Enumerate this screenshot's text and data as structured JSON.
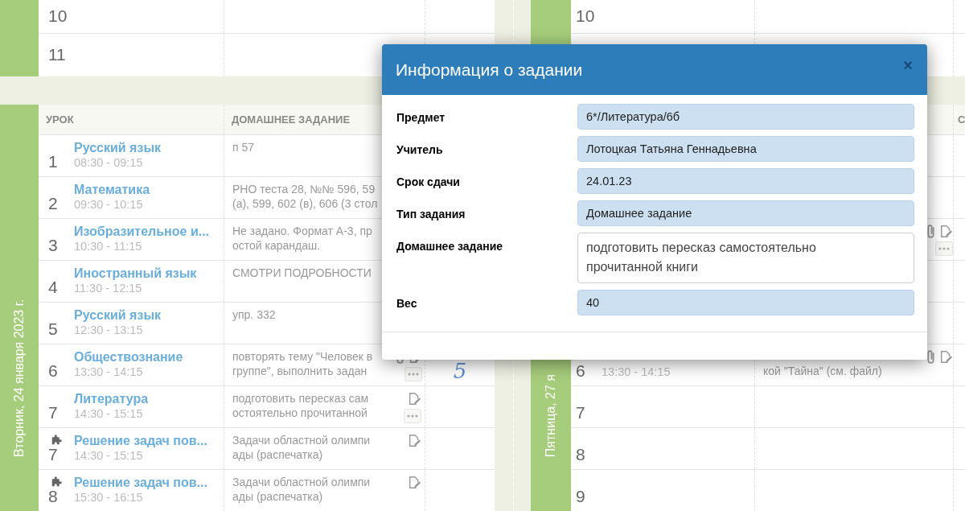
{
  "columns": [
    {
      "blocks": [
        {
          "kind": "tail",
          "rows": [
            {
              "number": "10"
            },
            {
              "number": "11"
            }
          ]
        },
        {
          "kind": "day",
          "date": "Вторник, 24 января 2023 г.",
          "headers": [
            "УРОК",
            "ДОМАШНЕЕ ЗАДАНИЕ"
          ],
          "rows": [
            {
              "number": "1",
              "title": "Русский язык",
              "time": "08:30 - 09:15",
              "homework": "п 57"
            },
            {
              "number": "2",
              "title": "Математика",
              "time": "09:30 - 10:15",
              "homework": "РНО теста 28, №№ 596, 59\n(а), 599, 602 (в), 606 (3 стол"
            },
            {
              "number": "3",
              "title": "Изобразительное и...",
              "time": "10:30 - 11:15",
              "homework": "Не задано. Формат А-3, пр\nостой карандаш."
            },
            {
              "number": "4",
              "title": "Иностранный язык",
              "time": "11:30 - 12:15",
              "homework": "СМОТРИ ПОДРОБНОСТИ"
            },
            {
              "number": "5",
              "title": "Русский язык",
              "time": "12:30 - 13:15",
              "homework": "упр. 332"
            },
            {
              "number": "6",
              "title": "Обществознание",
              "time": "13:30 - 14:15",
              "homework": "повторять тему \"Человек в\nгруппе\", выполнить задан",
              "icons": [
                {
                  "kind": "attachment"
                },
                {
                  "kind": "edit"
                },
                {
                  "kind": "more"
                }
              ],
              "mark": "5"
            },
            {
              "number": "7",
              "title": "Литература",
              "time": "14:30 - 15:15",
              "homework": "подготовить пересказ сам\nостоятельно прочитанной",
              "icons": [
                {
                  "kind": "edit"
                },
                {
                  "kind": "more"
                }
              ]
            },
            {
              "kind": "extra",
              "number": "7",
              "title": "Решение задач пов...",
              "time": "14:30 - 15:15",
              "homework": "Задачи областной олимпи\nады (распечатка)",
              "icons": [
                {
                  "kind": "edit"
                }
              ]
            },
            {
              "kind": "extra",
              "number": "8",
              "title": "Решение задач пов...",
              "time": "15:30 - 16:15",
              "homework": "Задачи областной олимпи\nады (распечатка)",
              "icons": [
                {
                  "kind": "edit"
                }
              ]
            }
          ]
        }
      ]
    },
    {
      "blocks": [
        {
          "kind": "tail",
          "rows": [
            {
              "number": "10"
            },
            {}
          ]
        },
        {
          "kind": "day",
          "date": "Пятница, 27 я",
          "header_column_3": "С",
          "rows": [
            {},
            {},
            {
              "icons": [
                {
                  "kind": "attachment"
                },
                {
                  "kind": "edit"
                },
                {
                  "kind": "more"
                }
              ]
            },
            {},
            {},
            {
              "number": "6",
              "time": "13:30 - 14:15",
              "homework": "кой \"Тайна\" (см. файл)",
              "icons": [
                {
                  "kind": "attachment"
                },
                {
                  "kind": "edit"
                }
              ]
            },
            {
              "number": "7"
            },
            {
              "number": "8"
            },
            {
              "number": "9"
            }
          ]
        }
      ]
    }
  ],
  "modal": {
    "title": "Информация о задании",
    "close": "×",
    "fields": [
      {
        "label": "Предмет",
        "value": "6*/Литература/6б",
        "kind": "readonly"
      },
      {
        "label": "Учитель",
        "value": "Лотоцкая Татьяна Геннадьевна",
        "kind": "readonly"
      },
      {
        "label": "Срок сдачи",
        "value": "24.01.23",
        "kind": "readonly"
      },
      {
        "label": "Тип задания",
        "value": "Домашнее задание",
        "kind": "readonly"
      },
      {
        "label": "Домашнее задание",
        "value": "подготовить пересказ самостоятельно прочитанной книги",
        "kind": "multiline"
      },
      {
        "label": "Вес",
        "value": "40",
        "kind": "readonly"
      }
    ]
  }
}
